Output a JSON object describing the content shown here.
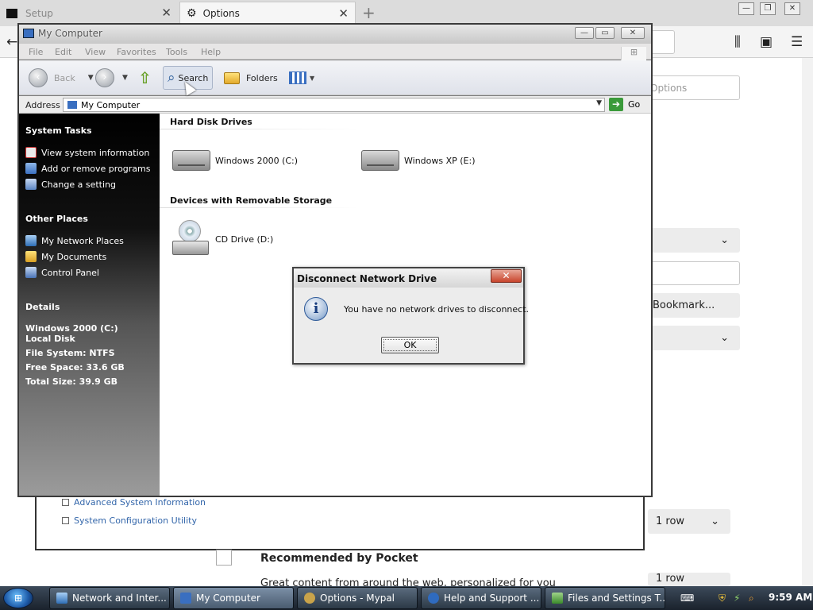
{
  "browser": {
    "tabs": [
      {
        "label": "Setup"
      },
      {
        "label": "Options"
      }
    ],
    "new_tab": "+",
    "content": {
      "search_placeholder": "Options",
      "bookmark_label": "Bookmark...",
      "pocket_title": "Recommended by Pocket",
      "pocket_desc": "Great content from around the web, personalized for you",
      "rows_label_1": "1 row",
      "rows_label_2": "1 row"
    },
    "links": [
      "Advanced System Information",
      "System Configuration Utility"
    ]
  },
  "window": {
    "title": "My Computer",
    "menu": [
      "File",
      "Edit",
      "View",
      "Favorites",
      "Tools",
      "Help"
    ],
    "toolbar": {
      "back": "Back",
      "search": "Search",
      "folders": "Folders"
    },
    "address": {
      "label": "Address",
      "value": "My Computer",
      "go": "Go"
    },
    "system_tasks": {
      "title": "System Tasks",
      "items": [
        "View system information",
        "Add or remove programs",
        "Change a setting"
      ]
    },
    "other_places": {
      "title": "Other Places",
      "items": [
        "My Network Places",
        "My Documents",
        "Control Panel"
      ]
    },
    "details": {
      "title": "Details",
      "name": "Windows 2000 (C:)",
      "type": "Local Disk",
      "file_system": "File System: NTFS",
      "free_space": "Free Space: 33.6 GB",
      "total_size": "Total Size: 39.9 GB"
    },
    "groups": {
      "hdd_title": "Hard Disk Drives",
      "drives": [
        "Windows 2000 (C:)",
        "Windows XP (E:)"
      ],
      "removable_title": "Devices with Removable Storage",
      "removable": [
        "CD Drive (D:)"
      ]
    }
  },
  "dialog": {
    "title": "Disconnect Network Drive",
    "message": "You have no network drives to disconnect.",
    "ok": "OK",
    "icon": "i"
  },
  "taskbar": {
    "items": [
      {
        "label": "Network and Inter..."
      },
      {
        "label": "My Computer"
      },
      {
        "label": "Options - Mypal"
      },
      {
        "label": "Help and Support ..."
      },
      {
        "label": "Files and Settings T..."
      }
    ],
    "clock": "9:59 AM"
  }
}
